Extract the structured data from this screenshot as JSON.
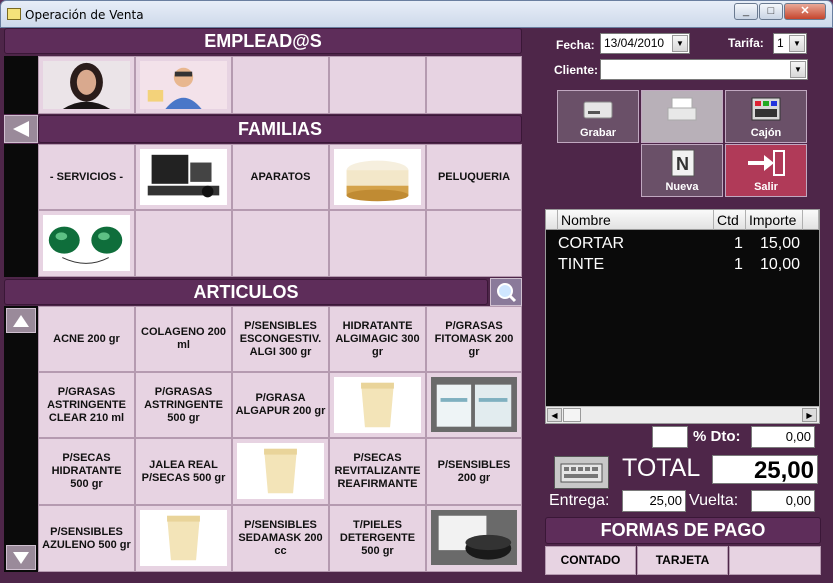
{
  "window": {
    "title": "Operación de Venta"
  },
  "sections": {
    "employees": "EMPLEAD@S",
    "families": "FAMILIAS",
    "articles": "ARTICULOS"
  },
  "families": {
    "servicios": "- SERVICIOS -",
    "aparatos": "APARATOS",
    "peluqueria": "PELUQUERIA"
  },
  "articles": {
    "r1": [
      "ACNE 200 gr",
      "COLAGENO 200 ml",
      "P/SENSIBLES ESCONGESTIV. ALGI 300 gr",
      "HIDRATANTE ALGIMAGIC 300 gr",
      "P/GRASAS FITOMASK 200 gr"
    ],
    "r2": [
      "P/GRASAS ASTRINGENTE CLEAR 210 ml",
      "P/GRASAS ASTRINGENTE 500 gr",
      "P/GRASA ALGAPUR 200 gr"
    ],
    "r3": [
      "P/SECAS HIDRATANTE 500 gr",
      "JALEA REAL P/SECAS 500 gr",
      "P/SECAS REVITALIZANTE REAFIRMANTE",
      "P/SENSIBLES 200 gr"
    ],
    "r4": [
      "P/SENSIBLES AZULENO 500 gr",
      "P/SENSIBLES SEDAMASK 200 cc",
      "T/PIELES DETERGENTE 500 gr"
    ]
  },
  "header": {
    "fecha_label": "Fecha:",
    "fecha_value": "13/04/2010",
    "tarifa_label": "Tarifa:",
    "tarifa_value": "1",
    "cliente_label": "Cliente:",
    "cliente_value": ""
  },
  "toolbar": {
    "grabar": "Grabar",
    "cajon": "Cajón",
    "nueva": "Nueva",
    "salir": "Salir"
  },
  "grid": {
    "columns": [
      "Nombre",
      "Ctd",
      "Importe"
    ],
    "rows": [
      {
        "nombre": "CORTAR",
        "ctd": "1",
        "importe": "15,00"
      },
      {
        "nombre": "TINTE",
        "ctd": "1",
        "importe": "10,00"
      }
    ]
  },
  "totals": {
    "dto_label": "% Dto:",
    "dto_value": "0,00",
    "total_label": "TOTAL",
    "total_value": "25,00",
    "entrega_label": "Entrega:",
    "entrega_value": "25,00",
    "vuelta_label": "Vuelta:",
    "vuelta_value": "0,00"
  },
  "payment": {
    "title": "FORMAS DE PAGO",
    "contado": "CONTADO",
    "tarjeta": "TARJETA"
  }
}
